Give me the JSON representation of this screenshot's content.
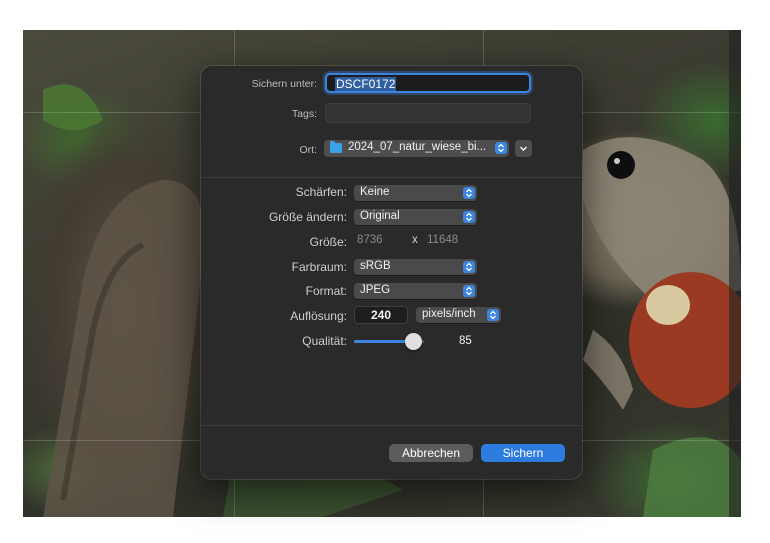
{
  "dialog": {
    "save_as_label": "Sichern unter:",
    "filename": "DSCF0172",
    "tags_label": "Tags:",
    "tags_value": "",
    "location_label": "Ort:",
    "location_value": "2024_07_natur_wiese_bi...",
    "sharpen_label": "Schärfen:",
    "sharpen_value": "Keine",
    "resize_label": "Größe ändern:",
    "resize_value": "Original",
    "size_label": "Größe:",
    "size_width": "8736",
    "size_sep": "x",
    "size_height": "11648",
    "colorspace_label": "Farbraum:",
    "colorspace_value": "sRGB",
    "format_label": "Format:",
    "format_value": "JPEG",
    "resolution_label": "Auflösung:",
    "resolution_value": "240",
    "resolution_unit": "pixels/inch",
    "quality_label": "Qualität:",
    "quality_value": "85",
    "quality_fraction": 0.85,
    "cancel_label": "Abbrechen",
    "save_label": "Sichern"
  },
  "colors": {
    "accent": "#2c7ce0",
    "dialog_bg": "#2a2a2a"
  },
  "icons": {
    "folder": "folder-icon",
    "popup": "chevron-updown-icon",
    "expand": "chevron-down-icon"
  }
}
